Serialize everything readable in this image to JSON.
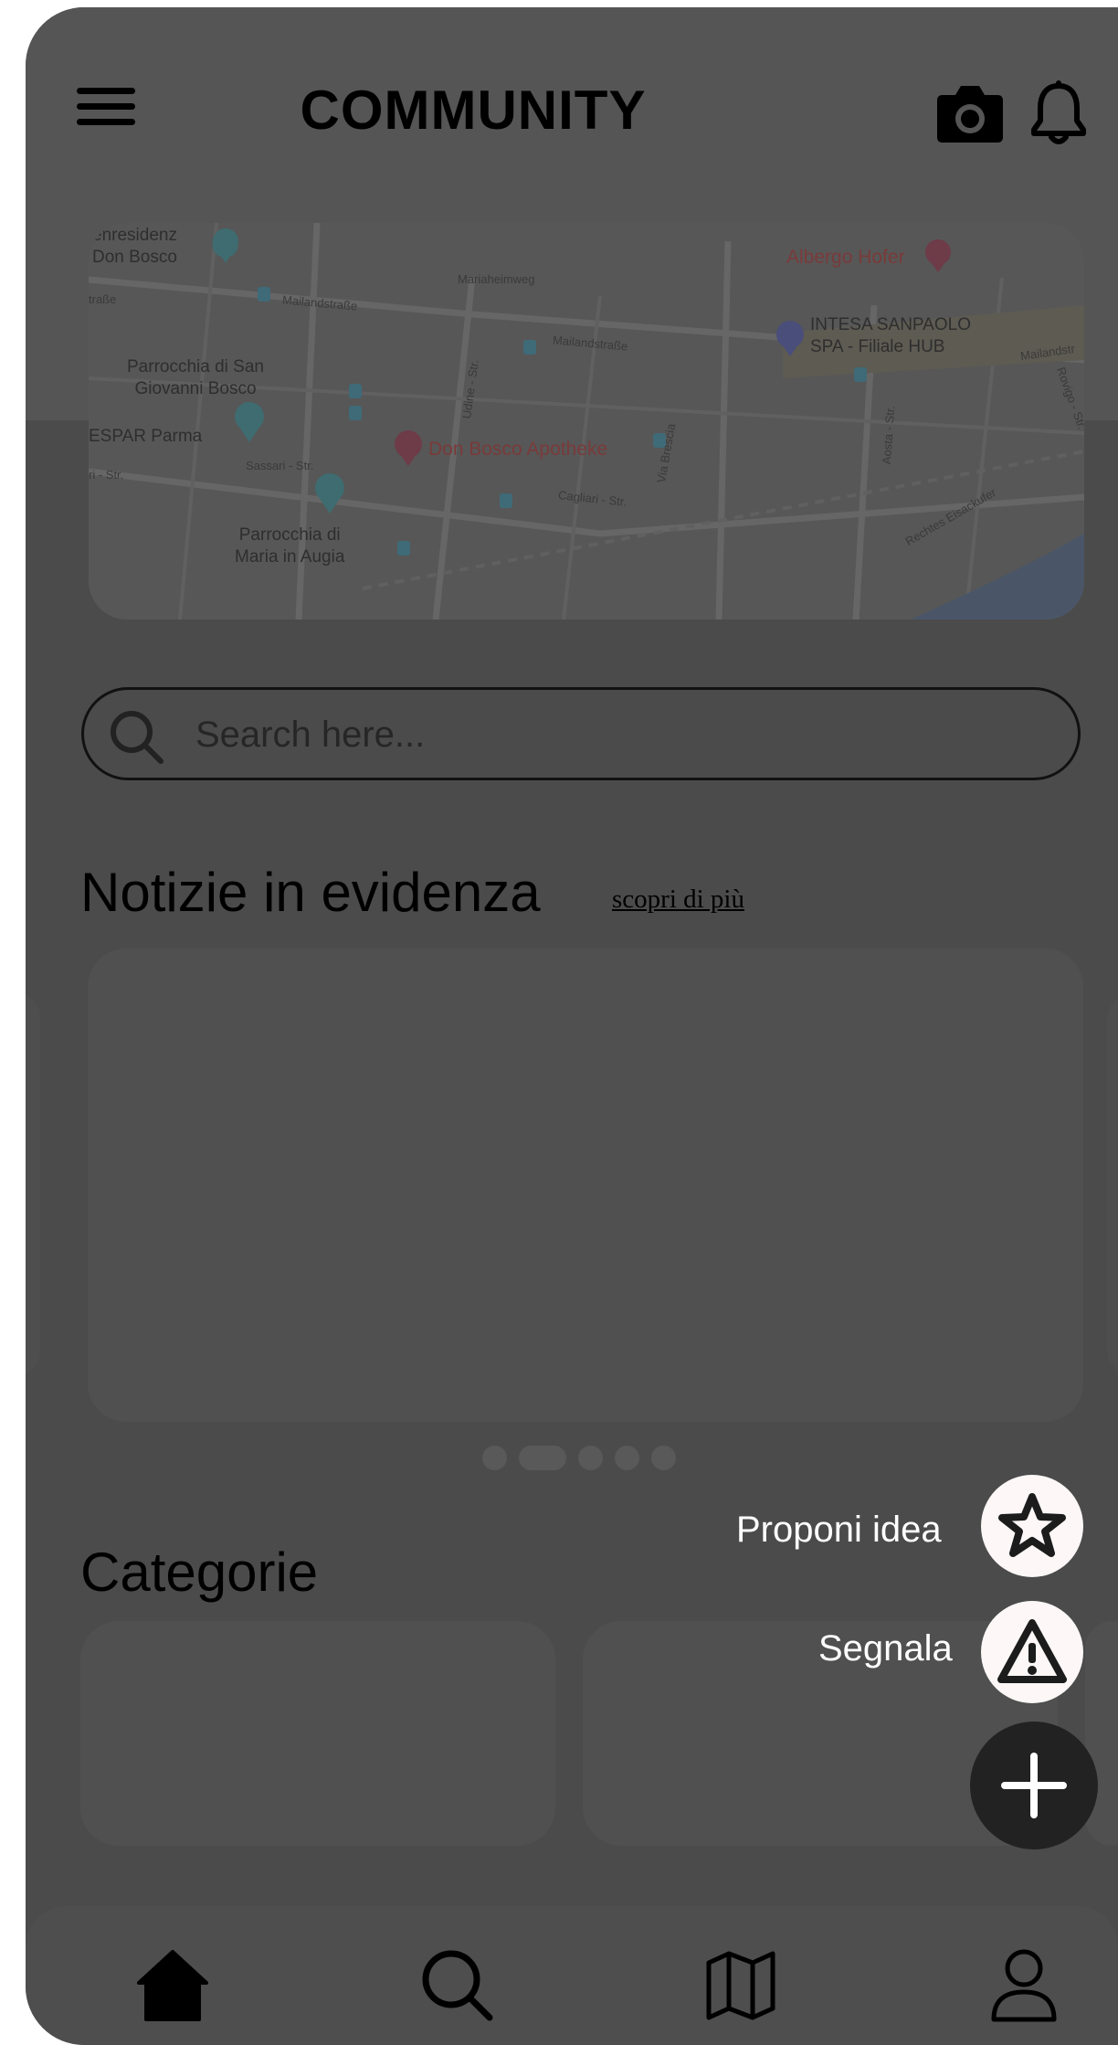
{
  "header": {
    "title": "COMMUNITY",
    "left_icon": "menu-icon",
    "right_icons": [
      "camera-icon",
      "bell-icon"
    ]
  },
  "map": {
    "labels": {
      "residence": "enresidenz\nDon Bosco",
      "church_san_giovanni": "Parrocchia di San\nGiovanni Bosco",
      "espar": "ESPAR Parma",
      "church_maria": "Parrocchia di\nMaria in Augia",
      "pharmacy": "Don Bosco Apotheke",
      "hotel": "Albergo Hofer",
      "bank": "INTESA SANPAOLO\nSPA - Filiale HUB",
      "street_mariaheim": "Mariaheimweg",
      "street_mailand_1": "Mailandstraße",
      "street_mailand_2": "Mailandstraße",
      "street_mailand_3": "Mailandstr",
      "street_strasse": "traße",
      "street_udine": "Udine - Str.",
      "street_sassari": "Sassari - Str.",
      "street_sassari_2": "ri - Str.",
      "street_cagliari": "Cagliari - Str.",
      "street_brescia": "Via Brescia",
      "street_aosta": "Aosta - Str.",
      "street_rechtes": "Rechtes Eisackufer",
      "street_rovigo": "Rovigo - Str."
    }
  },
  "search": {
    "placeholder": "Search here...",
    "value": ""
  },
  "news": {
    "title": "Notizie in evidenza",
    "link": "scopri di più",
    "active_slide": 1,
    "slide_count": 5
  },
  "categories": {
    "title": "Categorie"
  },
  "fab": {
    "propose_label": "Proponi idea",
    "propose_icon": "star-icon",
    "report_label": "Segnala",
    "report_icon": "warning-icon",
    "main_icon": "plus-icon"
  },
  "bottom_nav": {
    "items": [
      "home-icon",
      "search-icon",
      "map-icon",
      "user-icon"
    ],
    "active": "home-icon"
  },
  "colors": {
    "overlay_bg": "#4b4b4b",
    "fab_bg": "#222222",
    "fab_small_bg": "#fdf7f7"
  }
}
